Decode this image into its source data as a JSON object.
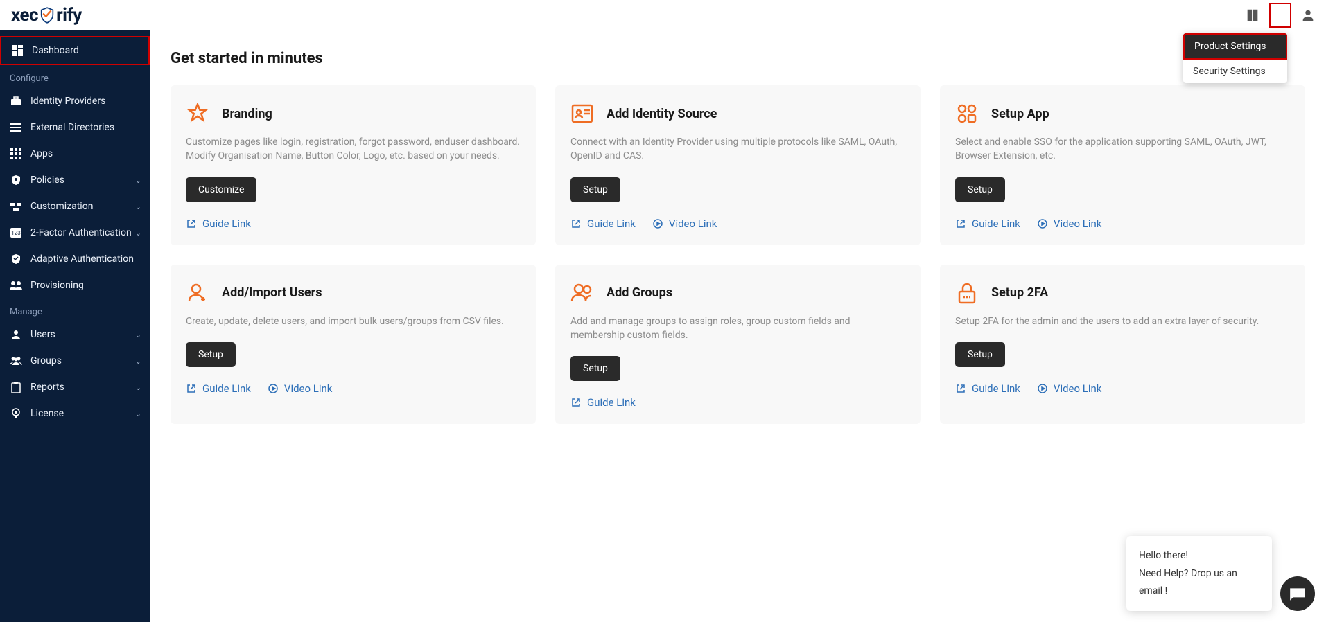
{
  "brand": "xecurify",
  "topbar": {
    "settings_menu": [
      "Product Settings",
      "Security Settings"
    ]
  },
  "sidebar": {
    "items": [
      {
        "label": "Dashboard",
        "active": true,
        "expandable": false
      },
      {
        "section": "Configure"
      },
      {
        "label": "Identity Providers",
        "expandable": false
      },
      {
        "label": "External Directories",
        "expandable": false
      },
      {
        "label": "Apps",
        "expandable": false
      },
      {
        "label": "Policies",
        "expandable": true
      },
      {
        "label": "Customization",
        "expandable": true
      },
      {
        "label": "2-Factor Authentication",
        "expandable": true
      },
      {
        "label": "Adaptive Authentication",
        "expandable": false
      },
      {
        "label": "Provisioning",
        "expandable": false
      },
      {
        "section": "Manage"
      },
      {
        "label": "Users",
        "expandable": true
      },
      {
        "label": "Groups",
        "expandable": true
      },
      {
        "label": "Reports",
        "expandable": true
      },
      {
        "label": "License",
        "expandable": true
      }
    ]
  },
  "main": {
    "title": "Get started in minutes",
    "cards": [
      {
        "title": "Branding",
        "desc": "Customize pages like login, registration, forgot password, enduser dashboard. Modify Organisation Name, Button Color, Logo, etc. based on your needs.",
        "button": "Customize",
        "guide": "Guide Link"
      },
      {
        "title": "Add Identity Source",
        "desc": "Connect with an Identity Provider using multiple protocols like SAML, OAuth, OpenID and CAS.",
        "button": "Setup",
        "guide": "Guide Link",
        "video": "Video Link"
      },
      {
        "title": "Setup App",
        "desc": "Select and enable SSO for the application supporting SAML, OAuth, JWT, Browser Extension, etc.",
        "button": "Setup",
        "guide": "Guide Link",
        "video": "Video Link"
      },
      {
        "title": "Add/Import Users",
        "desc": "Create, update, delete users, and import bulk users/groups from CSV files.",
        "button": "Setup",
        "guide": "Guide Link",
        "video": "Video Link"
      },
      {
        "title": "Add Groups",
        "desc": "Add and manage groups to assign roles, group custom fields and membership custom fields.",
        "button": "Setup",
        "guide": "Guide Link"
      },
      {
        "title": "Setup 2FA",
        "desc": "Setup 2FA for the admin and the users to add an extra layer of security.",
        "button": "Setup",
        "guide": "Guide Link",
        "video": "Video Link"
      }
    ]
  },
  "chat": {
    "line1": "Hello there!",
    "line2": "Need Help? Drop us an email !"
  }
}
